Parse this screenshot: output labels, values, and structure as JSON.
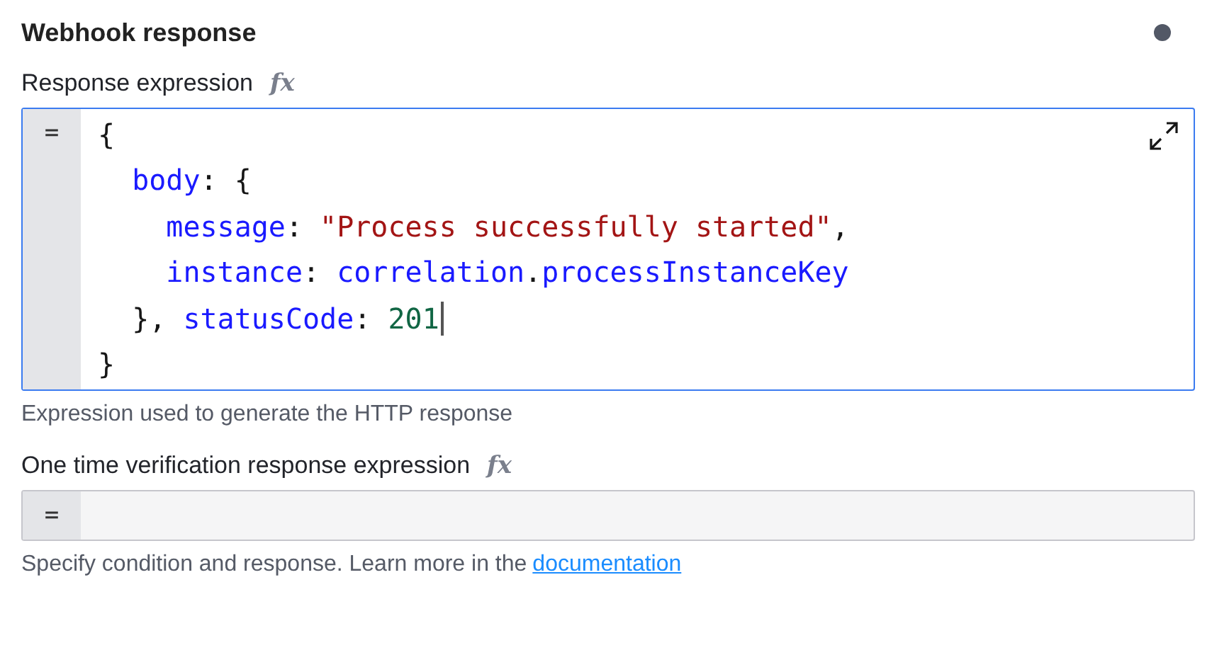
{
  "section": {
    "title": "Webhook response"
  },
  "fields": [
    {
      "kind": "code",
      "label": "Response expression",
      "fx": "fx",
      "prefix": "=",
      "focused": true,
      "lines": [
        {
          "caret": false,
          "tokens": [
            {
              "kind": "plain",
              "text": "{"
            }
          ]
        },
        {
          "caret": false,
          "tokens": [
            {
              "kind": "key",
              "text": "  body"
            },
            {
              "kind": "plain",
              "text": ": {"
            }
          ]
        },
        {
          "caret": false,
          "tokens": [
            {
              "kind": "key",
              "text": "    message"
            },
            {
              "kind": "plain",
              "text": ": "
            },
            {
              "kind": "string",
              "text": "\"Process successfully started\""
            },
            {
              "kind": "plain",
              "text": ","
            }
          ]
        },
        {
          "caret": false,
          "tokens": [
            {
              "kind": "key",
              "text": "    instance"
            },
            {
              "kind": "plain",
              "text": ": "
            },
            {
              "kind": "ident",
              "text": "correlation"
            },
            {
              "kind": "plain",
              "text": "."
            },
            {
              "kind": "ident",
              "text": "processInstanceKey"
            }
          ]
        },
        {
          "caret": true,
          "tokens": [
            {
              "kind": "plain",
              "text": "  }, "
            },
            {
              "kind": "key",
              "text": "statusCode"
            },
            {
              "kind": "plain",
              "text": ": "
            },
            {
              "kind": "number",
              "text": "201"
            }
          ]
        },
        {
          "caret": false,
          "tokens": [
            {
              "kind": "plain",
              "text": "}"
            }
          ]
        }
      ],
      "description": "Expression used to generate the HTTP response"
    },
    {
      "kind": "empty",
      "label": "One time verification response expression",
      "fx": "fx",
      "prefix": "=",
      "focused": false,
      "description": "Specify condition and response. Learn more in the",
      "link": "documentation"
    }
  ]
}
